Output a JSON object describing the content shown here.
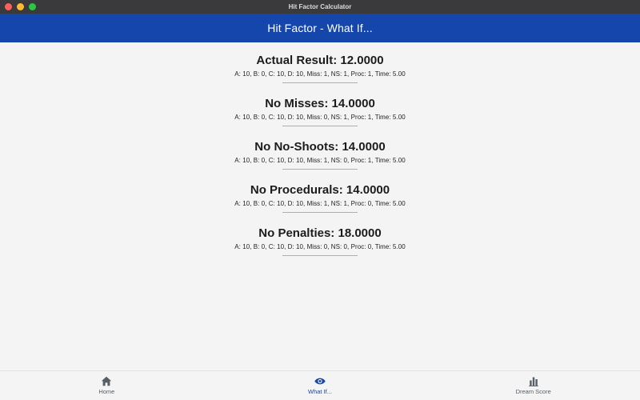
{
  "window": {
    "title": "Hit Factor Calculator"
  },
  "appbar": {
    "title": "Hit Factor - What If..."
  },
  "results": [
    {
      "heading": "Actual Result: 12.0000",
      "detail": "A: 10, B: 0, C: 10, D: 10, Miss: 1, NS: 1, Proc: 1, Time: 5.00"
    },
    {
      "heading": "No Misses: 14.0000",
      "detail": "A: 10, B: 0, C: 10, D: 10, Miss: 0, NS: 1, Proc: 1, Time: 5.00"
    },
    {
      "heading": "No No-Shoots: 14.0000",
      "detail": "A: 10, B: 0, C: 10, D: 10, Miss: 1, NS: 0, Proc: 1, Time: 5.00"
    },
    {
      "heading": "No Procedurals: 14.0000",
      "detail": "A: 10, B: 0, C: 10, D: 10, Miss: 1, NS: 1, Proc: 0, Time: 5.00"
    },
    {
      "heading": "No Penalties: 18.0000",
      "detail": "A: 10, B: 0, C: 10, D: 10, Miss: 0, NS: 0, Proc: 0, Time: 5.00"
    }
  ],
  "nav": {
    "items": [
      {
        "label": "Home",
        "icon": "home-icon",
        "active": false
      },
      {
        "label": "What If...",
        "icon": "eye-icon",
        "active": true
      },
      {
        "label": "Dream Score",
        "icon": "bar-chart-icon",
        "active": false
      }
    ]
  },
  "colors": {
    "appbar": "#1546ac",
    "active_nav": "#1546ac",
    "inactive_nav": "#585f66",
    "divider": "#a9b0b8"
  }
}
